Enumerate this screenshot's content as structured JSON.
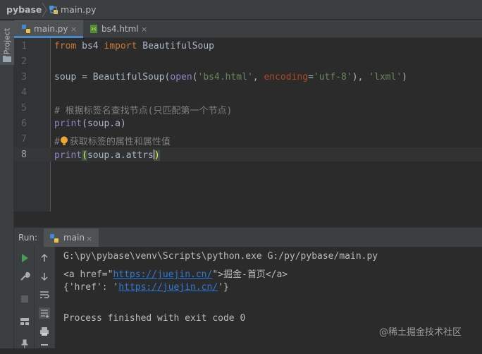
{
  "breadcrumb": {
    "project": "pybase",
    "file": "main.py"
  },
  "sidebar": {
    "project_label": "Project"
  },
  "tabs": [
    {
      "label": "main.py",
      "close": "×",
      "active": true
    },
    {
      "label": "bs4.html",
      "close": "×",
      "active": false
    }
  ],
  "editor": {
    "line_numbers": [
      "1",
      "2",
      "3",
      "4",
      "5",
      "6",
      "7",
      "8"
    ],
    "line1": {
      "kw_from": "from",
      "mod": " bs4 ",
      "kw_import": "import",
      "rest": " BeautifulSoup"
    },
    "line3": {
      "a": "soup = BeautifulSoup(",
      "open": "open",
      "b": "(",
      "s1": "'bs4.html'",
      "c": ", ",
      "param": "encoding",
      "d": "=",
      "s2": "'utf-8'",
      "e": "), ",
      "s3": "'lxml'",
      "f": ")"
    },
    "line5": {
      "comment": "# 根据标签名查找节点(只匹配第一个节点)"
    },
    "line6": {
      "print": "print",
      "rest": "(soup.a)"
    },
    "line7": {
      "hash": "#",
      "comment": "获取标签的属性和属性值"
    },
    "line8": {
      "print": "print",
      "paren": "(",
      "rest": "soup.a.attrs",
      "close": ")"
    }
  },
  "run": {
    "label": "Run:",
    "tab": "main",
    "close": "×",
    "console": {
      "cmd": "G:\\py\\pybase\\venv\\Scripts\\python.exe G:/py/pybase/main.py",
      "l2a": "<a href=\"",
      "l2link": "https://juejin.cn/",
      "l2b": "\">掘金-首页</a>",
      "l3a": "{'href': '",
      "l3link": "https://juejin.cn/",
      "l3b": "'}",
      "l5": "Process finished with exit code 0"
    }
  },
  "watermark": "@稀土掘金技术社区",
  "colors": {
    "keyword": "#cc7832",
    "string": "#6a8759",
    "comment": "#808080",
    "link": "#287bde",
    "run_green": "#499c54"
  }
}
